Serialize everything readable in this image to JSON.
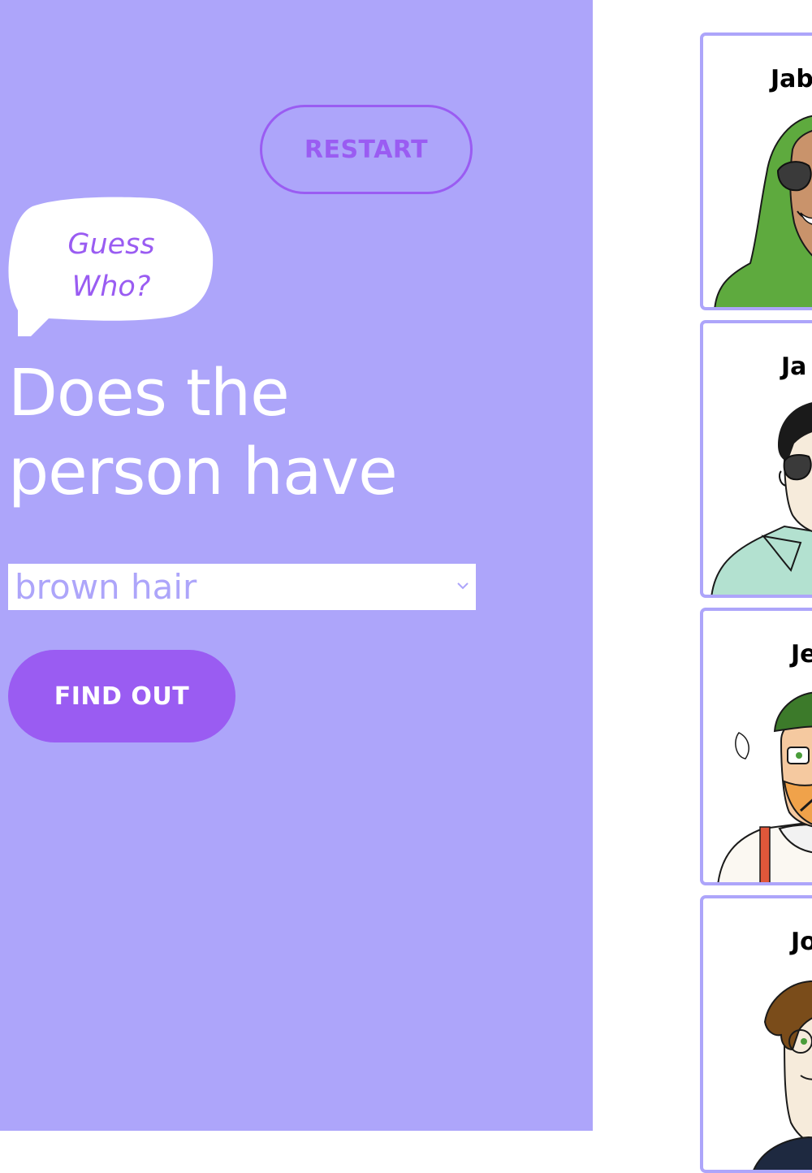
{
  "controls": {
    "restart_label": "RESTART",
    "find_label": "FIND OUT"
  },
  "bubble": {
    "line1": "Guess",
    "line2": "Who?"
  },
  "question": {
    "line1": "Does the",
    "line2": "person have"
  },
  "select": {
    "value": "brown hair"
  },
  "cards": [
    {
      "name": "Jab",
      "icon": "portrait-green-hijab-sunglasses"
    },
    {
      "name": "Ja",
      "icon": "portrait-dark-hair-sunglasses"
    },
    {
      "name": "Je",
      "icon": "portrait-green-beanie-glasses-beard"
    },
    {
      "name": "Jo",
      "icon": "portrait-brown-hair-glasses"
    }
  ],
  "colors": {
    "panel": "#ada5fa",
    "accent": "#9a5cf2",
    "text_on_panel": "#ffffff"
  }
}
